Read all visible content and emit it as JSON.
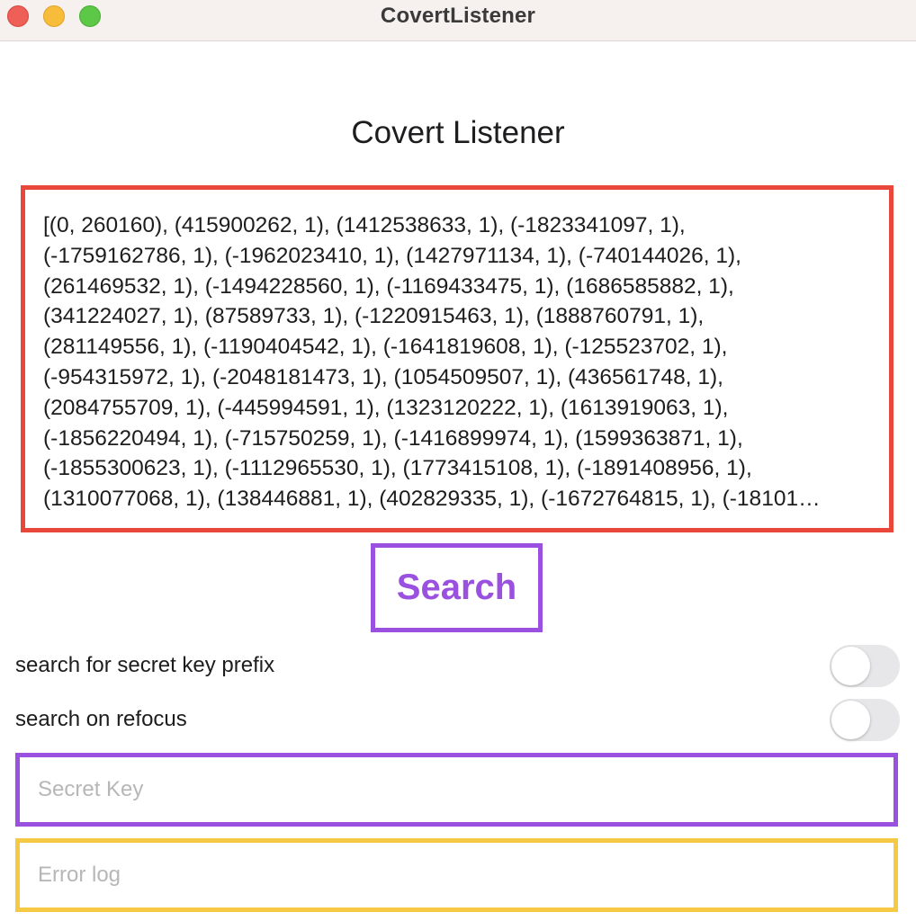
{
  "window": {
    "title": "CovertListener"
  },
  "app": {
    "heading": "Covert Listener"
  },
  "output": {
    "lines": [
      "[(0, 260160), (415900262, 1), (1412538633, 1), (-1823341097, 1),",
      "(-1759162786, 1), (-1962023410, 1), (1427971134, 1), (-740144026, 1),",
      "(261469532, 1), (-1494228560, 1), (-1169433475, 1), (1686585882, 1),",
      "(341224027, 1), (87589733, 1), (-1220915463, 1), (1888760791, 1),",
      "(281149556, 1), (-1190404542, 1), (-1641819608, 1), (-125523702, 1),",
      "(-954315972, 1), (-2048181473, 1), (1054509507, 1), (436561748, 1),",
      "(2084755709, 1), (-445994591, 1), (1323120222, 1), (1613919063, 1),",
      "(-1856220494, 1), (-715750259, 1), (-1416899974, 1), (1599363871, 1),",
      "(-1855300623, 1), (-1112965530, 1), (1773415108, 1), (-1891408956, 1),",
      "(1310077068, 1), (138446881, 1), (402829335, 1), (-1672764815, 1), (-18101…"
    ],
    "border_color": "#e8473a"
  },
  "search": {
    "label": "Search",
    "color": "#9b51e0"
  },
  "toggles": [
    {
      "label": "search for secret key prefix",
      "on": false
    },
    {
      "label": "search on refocus",
      "on": false
    }
  ],
  "inputs": {
    "secret_key": {
      "value": "",
      "placeholder": "Secret Key",
      "border_color": "#9b51e0"
    },
    "error_log": {
      "value": "",
      "placeholder": "Error log",
      "border_color": "#f6c944"
    }
  }
}
